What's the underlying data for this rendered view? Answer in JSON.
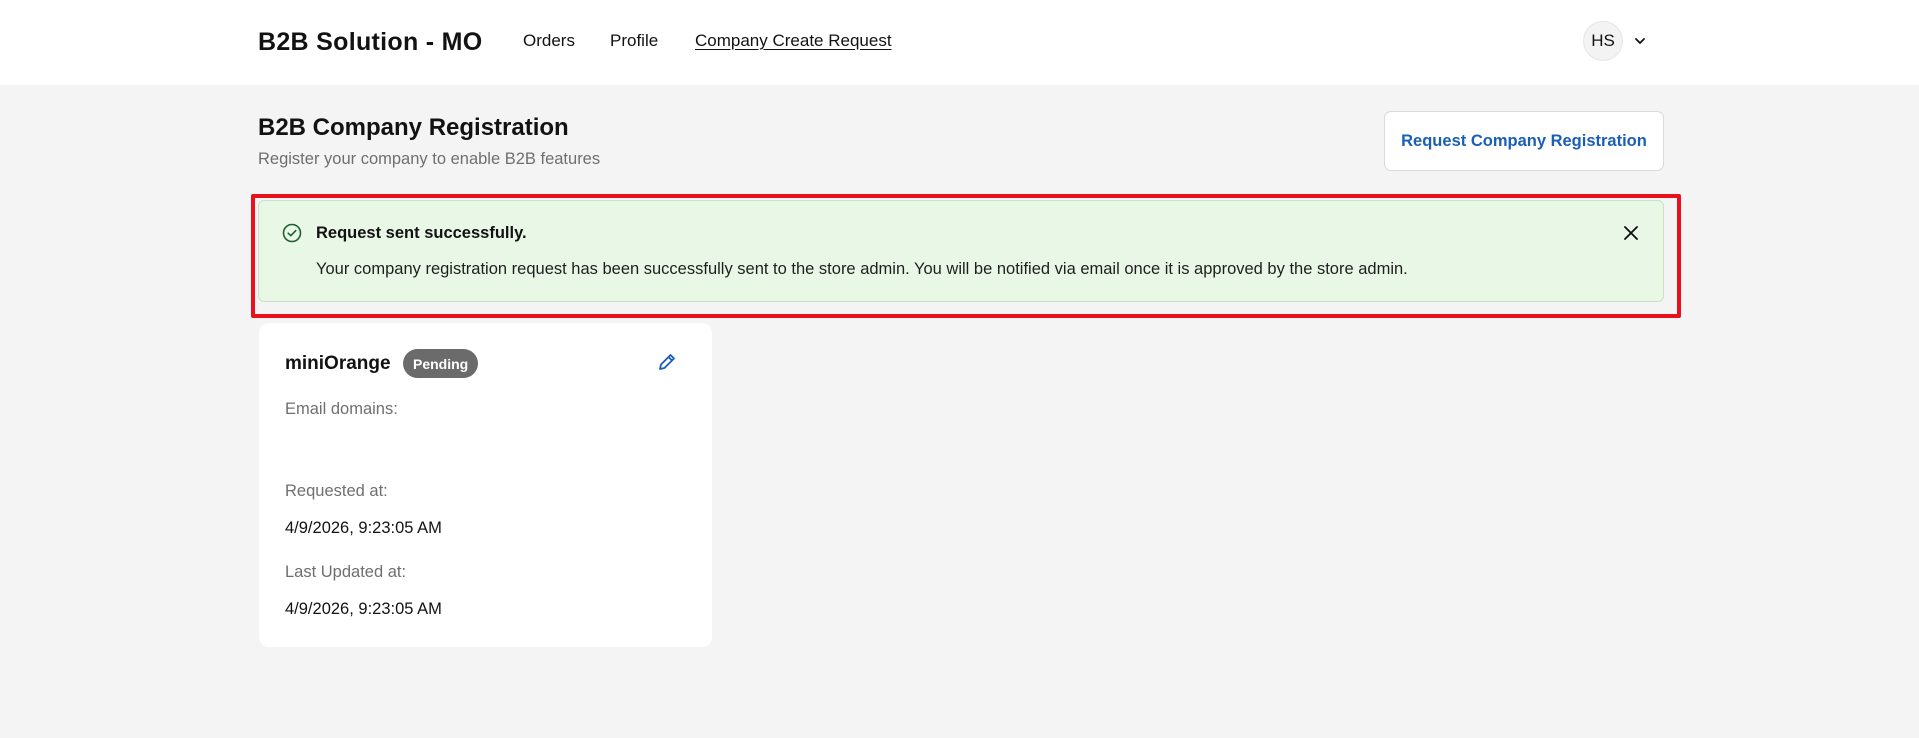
{
  "header": {
    "brand": "B2B Solution - MO",
    "nav": [
      {
        "label": "Orders"
      },
      {
        "label": "Profile"
      },
      {
        "label": "Company Create Request"
      }
    ],
    "account": {
      "initials": "HS"
    }
  },
  "page": {
    "title": "B2B Company Registration",
    "subtitle": "Register your company to enable B2B features",
    "request_button": "Request Company Registration"
  },
  "banner": {
    "title": "Request sent successfully.",
    "message": "Your company registration request has been successfully sent to the store admin. You will be notified via email once it is approved by the store admin."
  },
  "company": {
    "name": "miniOrange",
    "status": "Pending",
    "email_domains_label": "Email domains:",
    "email_domains_value": "",
    "requested_at_label": "Requested at:",
    "requested_at": "4/9/2026, 9:23:05 AM",
    "last_updated_label": "Last Updated at:",
    "last_updated": "4/9/2026, 9:23:05 AM"
  },
  "colors": {
    "accent": "#1a5fb4",
    "success_bg": "#e9f8e6",
    "highlight": "#e8101b",
    "badge": "#6b6b6b"
  }
}
